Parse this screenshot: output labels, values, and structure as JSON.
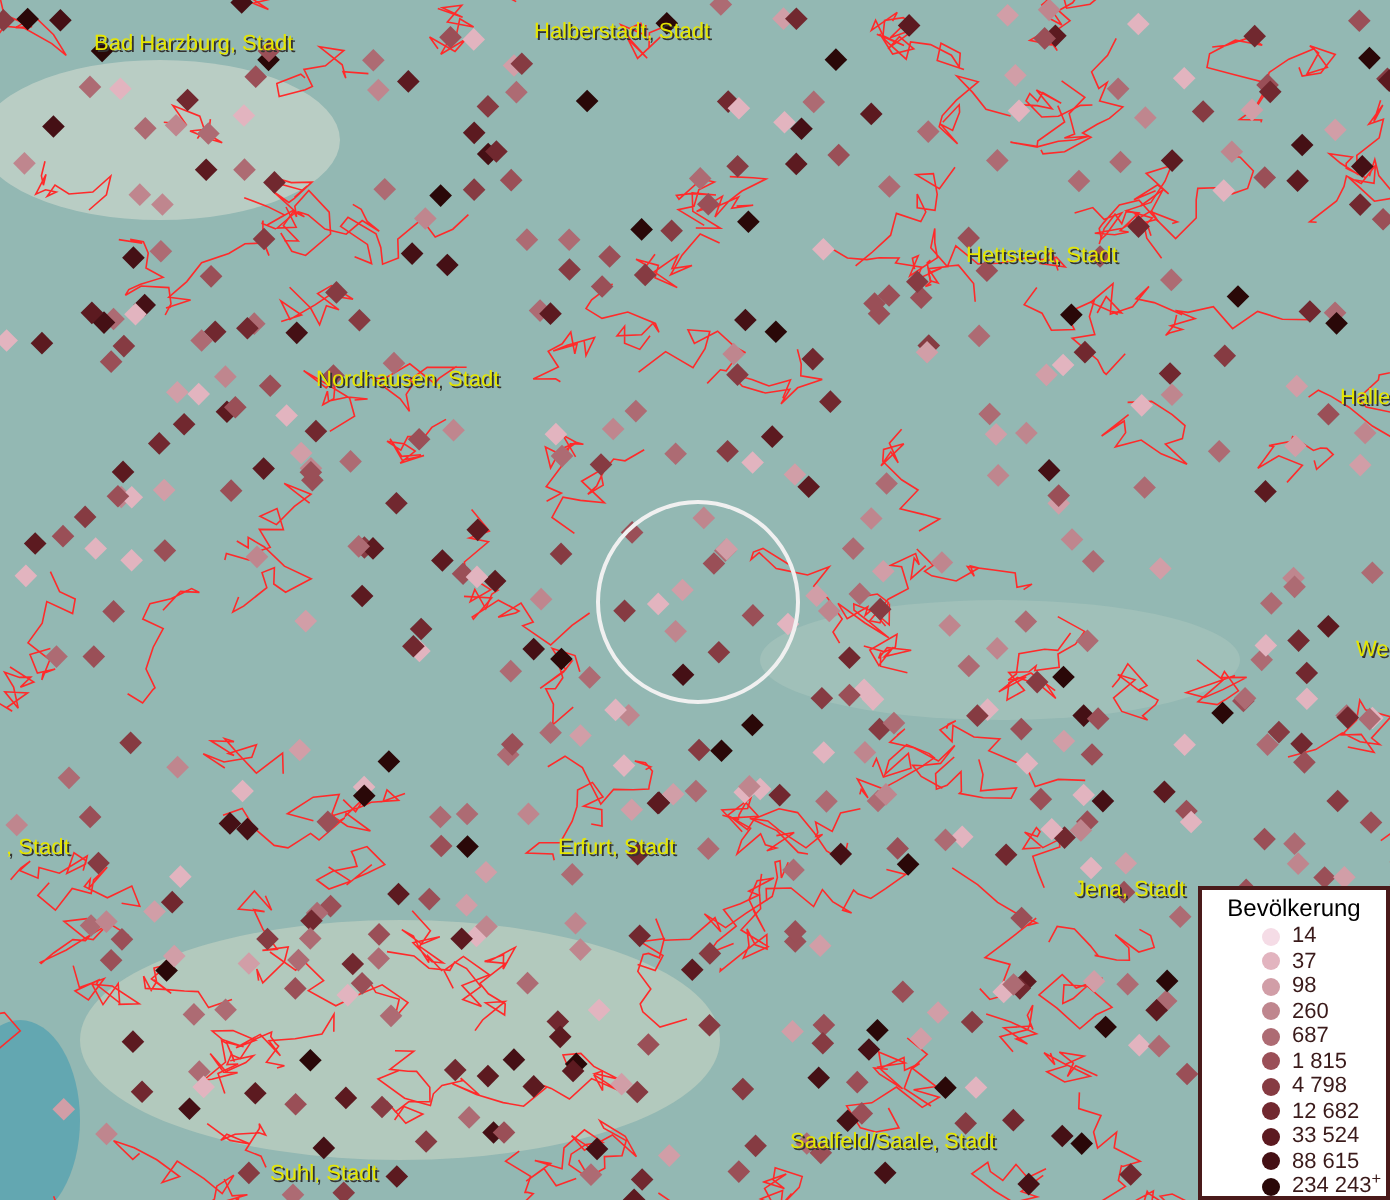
{
  "place_labels": [
    {
      "text": "Bad Harzburg, Stadt"
    },
    {
      "text": "Halberstadt, Stadt"
    },
    {
      "text": "Hettstedt, Stadt"
    },
    {
      "text": "Nordhausen, Stadt"
    },
    {
      "text": "Halle"
    },
    {
      "text": "We"
    },
    {
      "text": ", Stadt"
    },
    {
      "text": "Erfurt, Stadt"
    },
    {
      "text": "Jena, Stadt"
    },
    {
      "text": "Saalfeld/Saale, Stadt"
    },
    {
      "text": "Suhl, Stadt"
    }
  ],
  "legend": {
    "title": "Bevölkerung",
    "entries": [
      {
        "label": "14",
        "color": "#f5dce6"
      },
      {
        "label": "37",
        "color": "#e2b4bf"
      },
      {
        "label": "98",
        "color": "#d19ea7"
      },
      {
        "label": "260",
        "color": "#bf868e"
      },
      {
        "label": "687",
        "color": "#ad6b73"
      },
      {
        "label": "1 815",
        "color": "#9a4f57"
      },
      {
        "label": "4 798",
        "color": "#863b42"
      },
      {
        "label": "12 682",
        "color": "#71282f"
      },
      {
        "label": "33 524",
        "color": "#5c1a20"
      },
      {
        "label": "88 615",
        "color": "#451015"
      },
      {
        "label": "234 243$^{+}$",
        "color": "#2a0808"
      }
    ]
  }
}
